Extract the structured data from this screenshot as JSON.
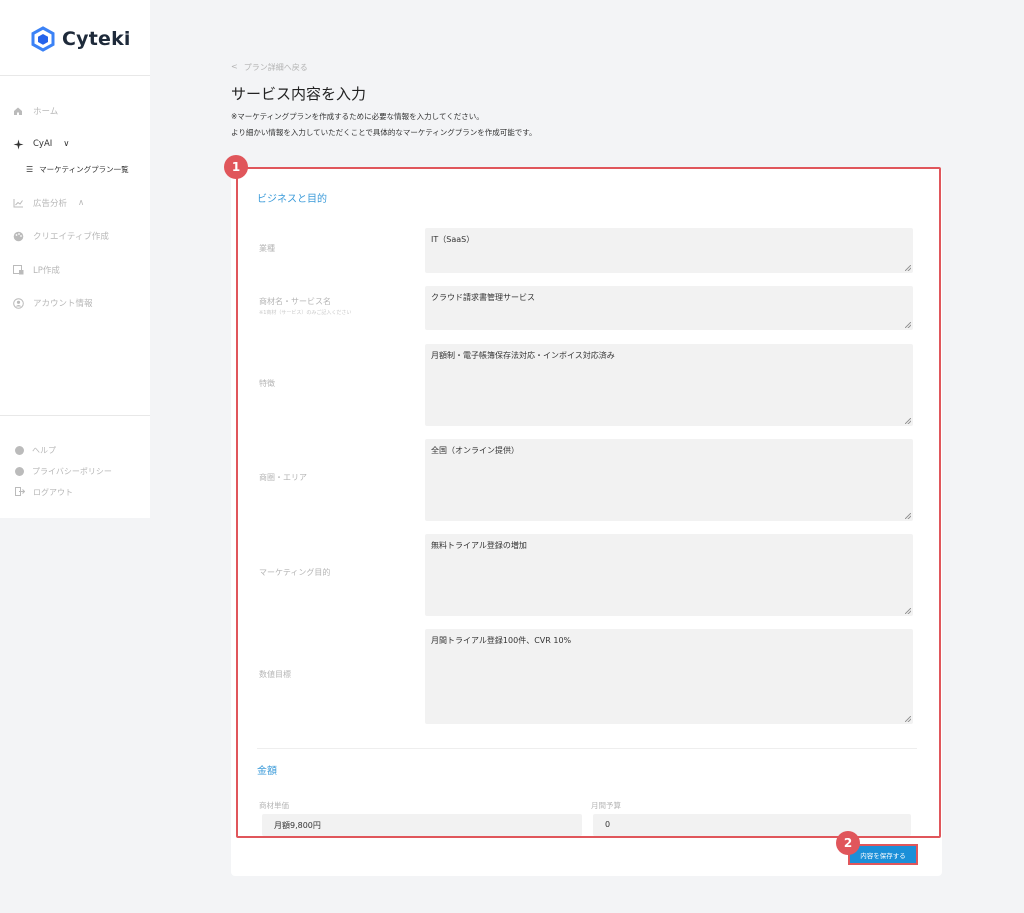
{
  "app": {
    "name": "Cyteki",
    "brand_color": "#3b82f6"
  },
  "sidebar": {
    "items": [
      {
        "label": "ホーム",
        "icon": "home-icon"
      },
      {
        "label": "CyAI",
        "icon": "sparkle-icon",
        "chevron": "∨"
      },
      {
        "label": "広告分析",
        "icon": "chart-icon",
        "chevron": "∧"
      },
      {
        "label": "クリエイティブ作成",
        "icon": "palette-icon"
      },
      {
        "label": "LP作成",
        "icon": "lp-icon"
      },
      {
        "label": "アカウント情報",
        "icon": "account-icon"
      }
    ],
    "sub_item": {
      "label": "マーケティングプラン一覧",
      "icon": "list-icon"
    },
    "bottom_items": [
      {
        "label": "ヘルプ",
        "icon": "help-icon"
      },
      {
        "label": "プライバシーポリシー",
        "icon": "info-icon"
      },
      {
        "label": "ログアウト",
        "icon": "logout-icon"
      }
    ]
  },
  "header": {
    "back_link": "プラン詳細へ戻る",
    "title": "サービス内容を入力",
    "desc1": "※マーケティングプランを作成するために必要な情報を入力してください。",
    "desc2": "より細かい情報を入力していただくことで具体的なマーケティングプランを作成可能です。"
  },
  "form": {
    "section1": "ビジネスと目的",
    "fields": [
      {
        "label": "業種",
        "value": "IT（SaaS）"
      },
      {
        "label": "商材名・サービス名",
        "sublabel": "※1商材（サービス）のみご記入ください",
        "value": "クラウド請求書管理サービス"
      },
      {
        "label": "特徴",
        "value": "月額制・電子帳簿保存法対応・インボイス対応済み"
      },
      {
        "label": "商圏・エリア",
        "value": "全国（オンライン提供）"
      },
      {
        "label": "マーケティング目的",
        "value": "無料トライアル登録の増加"
      },
      {
        "label": "数値目標",
        "value": "月間トライアル登録100件、CVR 10%"
      }
    ],
    "section2": "金額",
    "price_label": "商材単価",
    "price_value": "月額9,800円",
    "budget_label": "月間予算",
    "budget_value": "0"
  },
  "actions": {
    "save_label": "内容を保存する"
  },
  "annotations": {
    "badge1": "1",
    "badge2": "2"
  }
}
